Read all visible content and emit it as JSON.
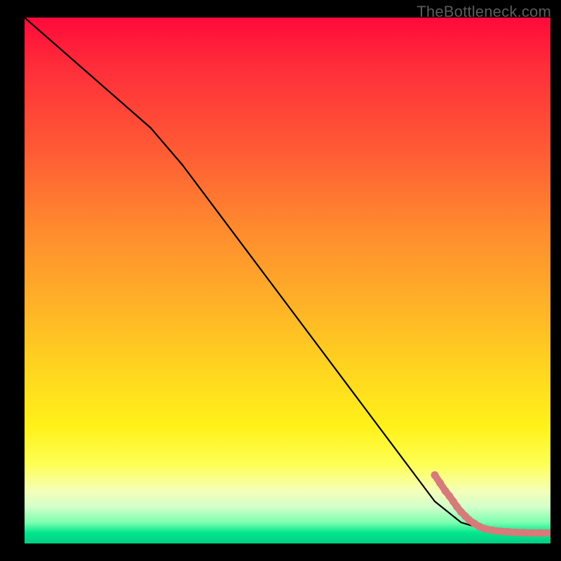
{
  "watermark": "TheBottleneck.com",
  "chart_data": {
    "type": "line",
    "title": "",
    "xlabel": "",
    "ylabel": "",
    "xlim": [
      0,
      100
    ],
    "ylim": [
      0,
      100
    ],
    "grid": false,
    "series": [
      {
        "name": "curve",
        "style": "black-line",
        "points": [
          {
            "x": 0,
            "y": 100
          },
          {
            "x": 24,
            "y": 79
          },
          {
            "x": 30,
            "y": 72
          },
          {
            "x": 78,
            "y": 8
          },
          {
            "x": 83,
            "y": 4
          },
          {
            "x": 88,
            "y": 2.5
          },
          {
            "x": 93,
            "y": 2
          },
          {
            "x": 100,
            "y": 2
          }
        ]
      },
      {
        "name": "markers",
        "style": "salmon-dots",
        "points": [
          {
            "x": 78,
            "y": 13
          },
          {
            "x": 79,
            "y": 11.5
          },
          {
            "x": 80,
            "y": 10
          },
          {
            "x": 80.8,
            "y": 9
          },
          {
            "x": 81.5,
            "y": 8
          },
          {
            "x": 82.2,
            "y": 7
          },
          {
            "x": 83,
            "y": 6
          },
          {
            "x": 83.8,
            "y": 5.2
          },
          {
            "x": 84.5,
            "y": 4.5
          },
          {
            "x": 85.5,
            "y": 3.8
          },
          {
            "x": 86.5,
            "y": 3.2
          },
          {
            "x": 87.5,
            "y": 2.8
          },
          {
            "x": 89,
            "y": 2.5
          },
          {
            "x": 90.5,
            "y": 2.3
          },
          {
            "x": 92,
            "y": 2.2
          },
          {
            "x": 93.5,
            "y": 2.1
          },
          {
            "x": 95,
            "y": 2.05
          },
          {
            "x": 96.5,
            "y": 2.0
          },
          {
            "x": 98,
            "y": 2.0
          },
          {
            "x": 100,
            "y": 2.0
          }
        ]
      }
    ],
    "background_gradient": {
      "direction": "vertical",
      "top": "#ff0a3a",
      "bottom": "#00cf84"
    }
  }
}
